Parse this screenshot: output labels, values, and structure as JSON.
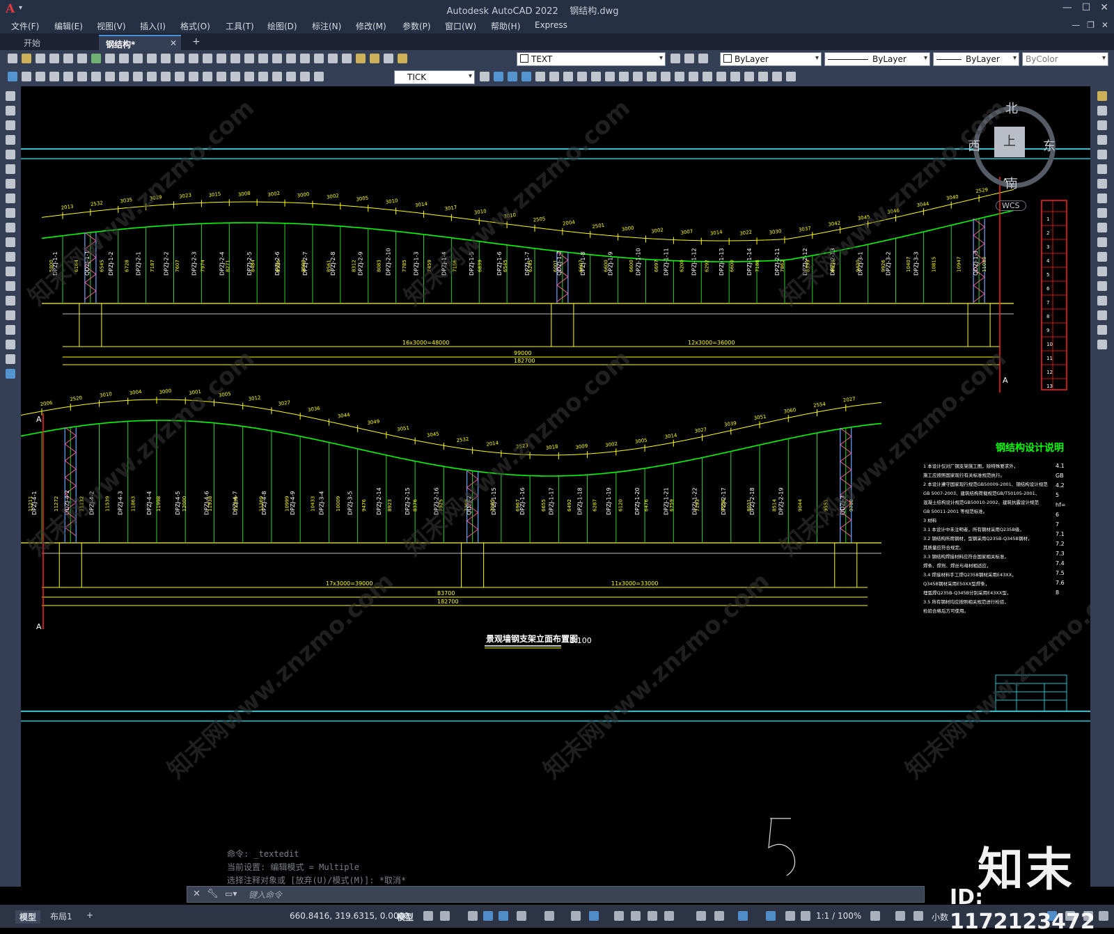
{
  "window": {
    "app_title": "Autodesk AutoCAD 2022",
    "file_title": "钢结构.dwg",
    "app_logo": "A",
    "controls": [
      "—",
      "☐",
      "✕"
    ]
  },
  "menu": [
    "文件(F)",
    "编辑(E)",
    "视图(V)",
    "插入(I)",
    "格式(O)",
    "工具(T)",
    "绘图(D)",
    "标注(N)",
    "修改(M)",
    "参数(P)",
    "窗口(W)",
    "帮助(H)",
    "Express"
  ],
  "doc_tabs": [
    {
      "label": "开始"
    },
    {
      "label": "钢结构*"
    }
  ],
  "toolbar": {
    "text_style": "TEXT",
    "dim_style": "TICK",
    "color": "ByLayer",
    "linetype": "ByLayer",
    "lineweight": "ByLayer",
    "plotstyle": "ByColor"
  },
  "viewcube": {
    "top": "上",
    "north": "北",
    "south": "南",
    "east": "东",
    "west": "西",
    "wcs": "WCS"
  },
  "drawing": {
    "title": "景观墙钢支架立面布置图",
    "scale": "1:100",
    "notes_title": "钢结构设计说明",
    "section_mark": "A",
    "total_length": "182700",
    "upper": {
      "dim_left": "16x3000=48000",
      "dim_right": "12x3000=36000",
      "dim_total": "99000",
      "arc_labels": [
        "2013",
        "2532",
        "3035",
        "3029",
        "3023",
        "3015",
        "3008",
        "3002",
        "3000",
        "3002",
        "3005",
        "3010",
        "3014",
        "3017",
        "3010",
        "3010",
        "2505",
        "2004",
        "2501",
        "3000",
        "3002",
        "3007",
        "3014",
        "3022",
        "3030",
        "3037",
        "3042",
        "3045",
        "3046",
        "3044",
        "3040",
        "2529"
      ],
      "truss_labels": [
        "QDZJ-1-1",
        "QDZJ-1-2",
        "QDZJ-1-3"
      ],
      "column_labels": [
        "DPZJ-1-1",
        "DPZJ-1-2",
        "DPZJ-2-1",
        "DPZJ-2-2",
        "DPZJ-2-3",
        "DPZJ-2-4",
        "DPZJ-2-5",
        "DPZJ-2-6",
        "DPZJ-2-7",
        "DPZJ-2-8",
        "DPZJ-2-9",
        "DPZJ-2-10",
        "DPZJ-1-3",
        "DPZJ-1-4",
        "DPZJ-1-5",
        "DPZJ-1-6",
        "DPZJ-1-7",
        "DPZJ-1-8",
        "DPZJ-1-9",
        "DPZJ-1-10",
        "DPZJ-1-11",
        "DPZJ-1-12",
        "DPZJ-1-13",
        "DPZJ-1-14",
        "DPZJ-2-11",
        "DPZJ-2-12",
        "DPZJ-2-13",
        "DPZJ-3-1",
        "DPZJ-3-2",
        "DPZJ-3-3"
      ],
      "height_labels": [
        "5800",
        "6164",
        "6545",
        "6728",
        "7187",
        "7607",
        "7974",
        "8271",
        "8484",
        "8556",
        "8598",
        "8561",
        "8312",
        "8083",
        "7785",
        "7459",
        "7156",
        "6839",
        "6545",
        "6245",
        "6001",
        "6607",
        "6600",
        "6600",
        "6697",
        "6200",
        "6292",
        "6600",
        "7188",
        "7862",
        "8359",
        "8893",
        "9420",
        "9926",
        "10407",
        "10815",
        "10947",
        "11083"
      ]
    },
    "lower": {
      "dim_left": "17x3000=39000",
      "dim_right": "11x3000=33000",
      "dim_total": "83700",
      "arc_labels": [
        "2006",
        "2520",
        "3010",
        "3004",
        "3000",
        "3001",
        "3005",
        "3012",
        "3027",
        "3036",
        "3044",
        "3049",
        "3051",
        "3045",
        "2532",
        "2014",
        "2523",
        "3018",
        "3009",
        "3002",
        "3005",
        "3014",
        "3027",
        "3039",
        "3051",
        "3060",
        "2554",
        "2027"
      ],
      "truss_labels": [
        "QDZJ-4-2",
        "QDZJ-2",
        "QDZJ-3"
      ],
      "column_labels": [
        "DPZJ-4-1",
        "DPZJ-4-2",
        "DPZJ-4-3",
        "DPZJ-4-4",
        "DPZJ-4-5",
        "DPZJ-4-6",
        "DPZJ-4-7",
        "DPZJ-4-8",
        "DPZJ-4-9",
        "DPZJ-3-4",
        "DPZJ-3-5",
        "DPZJ-2-14",
        "DPZJ-2-15",
        "DPZJ-2-16",
        "DPZJ-1-15",
        "DPZJ-1-16",
        "DPZJ-1-17",
        "DPZJ-1-18",
        "DPZJ-1-19",
        "DPZJ-1-20",
        "DPZJ-1-21",
        "DPZJ-1-22",
        "DPZJ-2-17",
        "DPZJ-2-18",
        "DPZJ-2-19"
      ],
      "height_labels": [
        "11211",
        "11272",
        "11132",
        "11539",
        "11863",
        "11998",
        "12000",
        "11938",
        "11735",
        "11369",
        "10999",
        "10433",
        "10009",
        "9476",
        "8923",
        "8376",
        "7925",
        "7298",
        "7125",
        "6967",
        "6655",
        "6492",
        "6287",
        "6120",
        "6476",
        "6759",
        "7193",
        "7558",
        "8031",
        "8514",
        "9044",
        "9551",
        "9700"
      ]
    },
    "notes": [
      "1 本设计仅对厂钢支架施工图，除特殊要求外，",
      "   施工应按照国家现行有关标准规范执行。",
      "2 本设计遵守国家现行规范GB50009-2001、钢结构设计规范",
      "   GB 5007-2003、建筑结构荷载规范GB/T50105-2001、",
      "   混凝土结构设计规范GB50010-2002、建筑抗震设计规范",
      "   GB 50011-2001 等规范标准。",
      "3 材料",
      "3.1 本设计中未注明者，所有钢材采用Q235B级，",
      "3.2 钢结构所用钢材，型钢采用Q235B-Q345B钢材，",
      "   其质量应符合规定。",
      "3.3 钢结构焊接材料应符合国家相关标准，",
      "   焊条、焊剂、焊丝与母材相适应，",
      "3.4 焊接材料手工焊Q235B钢材采用E43XX，",
      "   Q345B钢材采用E50XX型焊条，",
      "   埋弧焊Q235B-Q345B分别采用E43XX型，",
      "3.5 所有钢材均应按照相关规范进行检验，",
      "   检验合格后方可使用。"
    ],
    "notes_side": [
      "4.1",
      "GB",
      "4.2",
      "5 ",
      "hf=",
      "6 ",
      "7 ",
      "7.1",
      "7.2",
      "7.3",
      "7.4",
      "7.5",
      "7.6",
      "8 "
    ],
    "table_rows": [
      "1",
      "2",
      "3",
      "4",
      "5",
      "6",
      "7",
      "8",
      "9",
      "10",
      "11",
      "12",
      "13"
    ],
    "block_5": "5"
  },
  "command": {
    "history": [
      "命令: _textedit",
      "当前设置: 编辑模式 = Multiple",
      "选择注释对象或 [放弃(U)/模式(M)]: *取消*"
    ],
    "placeholder": "键入命令"
  },
  "status": {
    "layout_tabs": [
      "模型",
      "布局1"
    ],
    "coords": "660.8416, 319.6315, 0.0000",
    "model_label": "模型",
    "scale": "1:1 / 100%",
    "units": "小数"
  },
  "watermark": {
    "logo": "知末",
    "id": "ID: 1172123472",
    "diag_text": "知末网www.znzmo.com"
  },
  "colors": {
    "canvas": "#000000",
    "frame_cyan": "#19c7d6",
    "dim_yellow": "#ffff00",
    "curve_green": "#00ff00",
    "column_green": "#2bd22b",
    "truss_blue": "#6aa7ff",
    "mark_red": "#ff2020",
    "label_white": "#ffffff"
  }
}
